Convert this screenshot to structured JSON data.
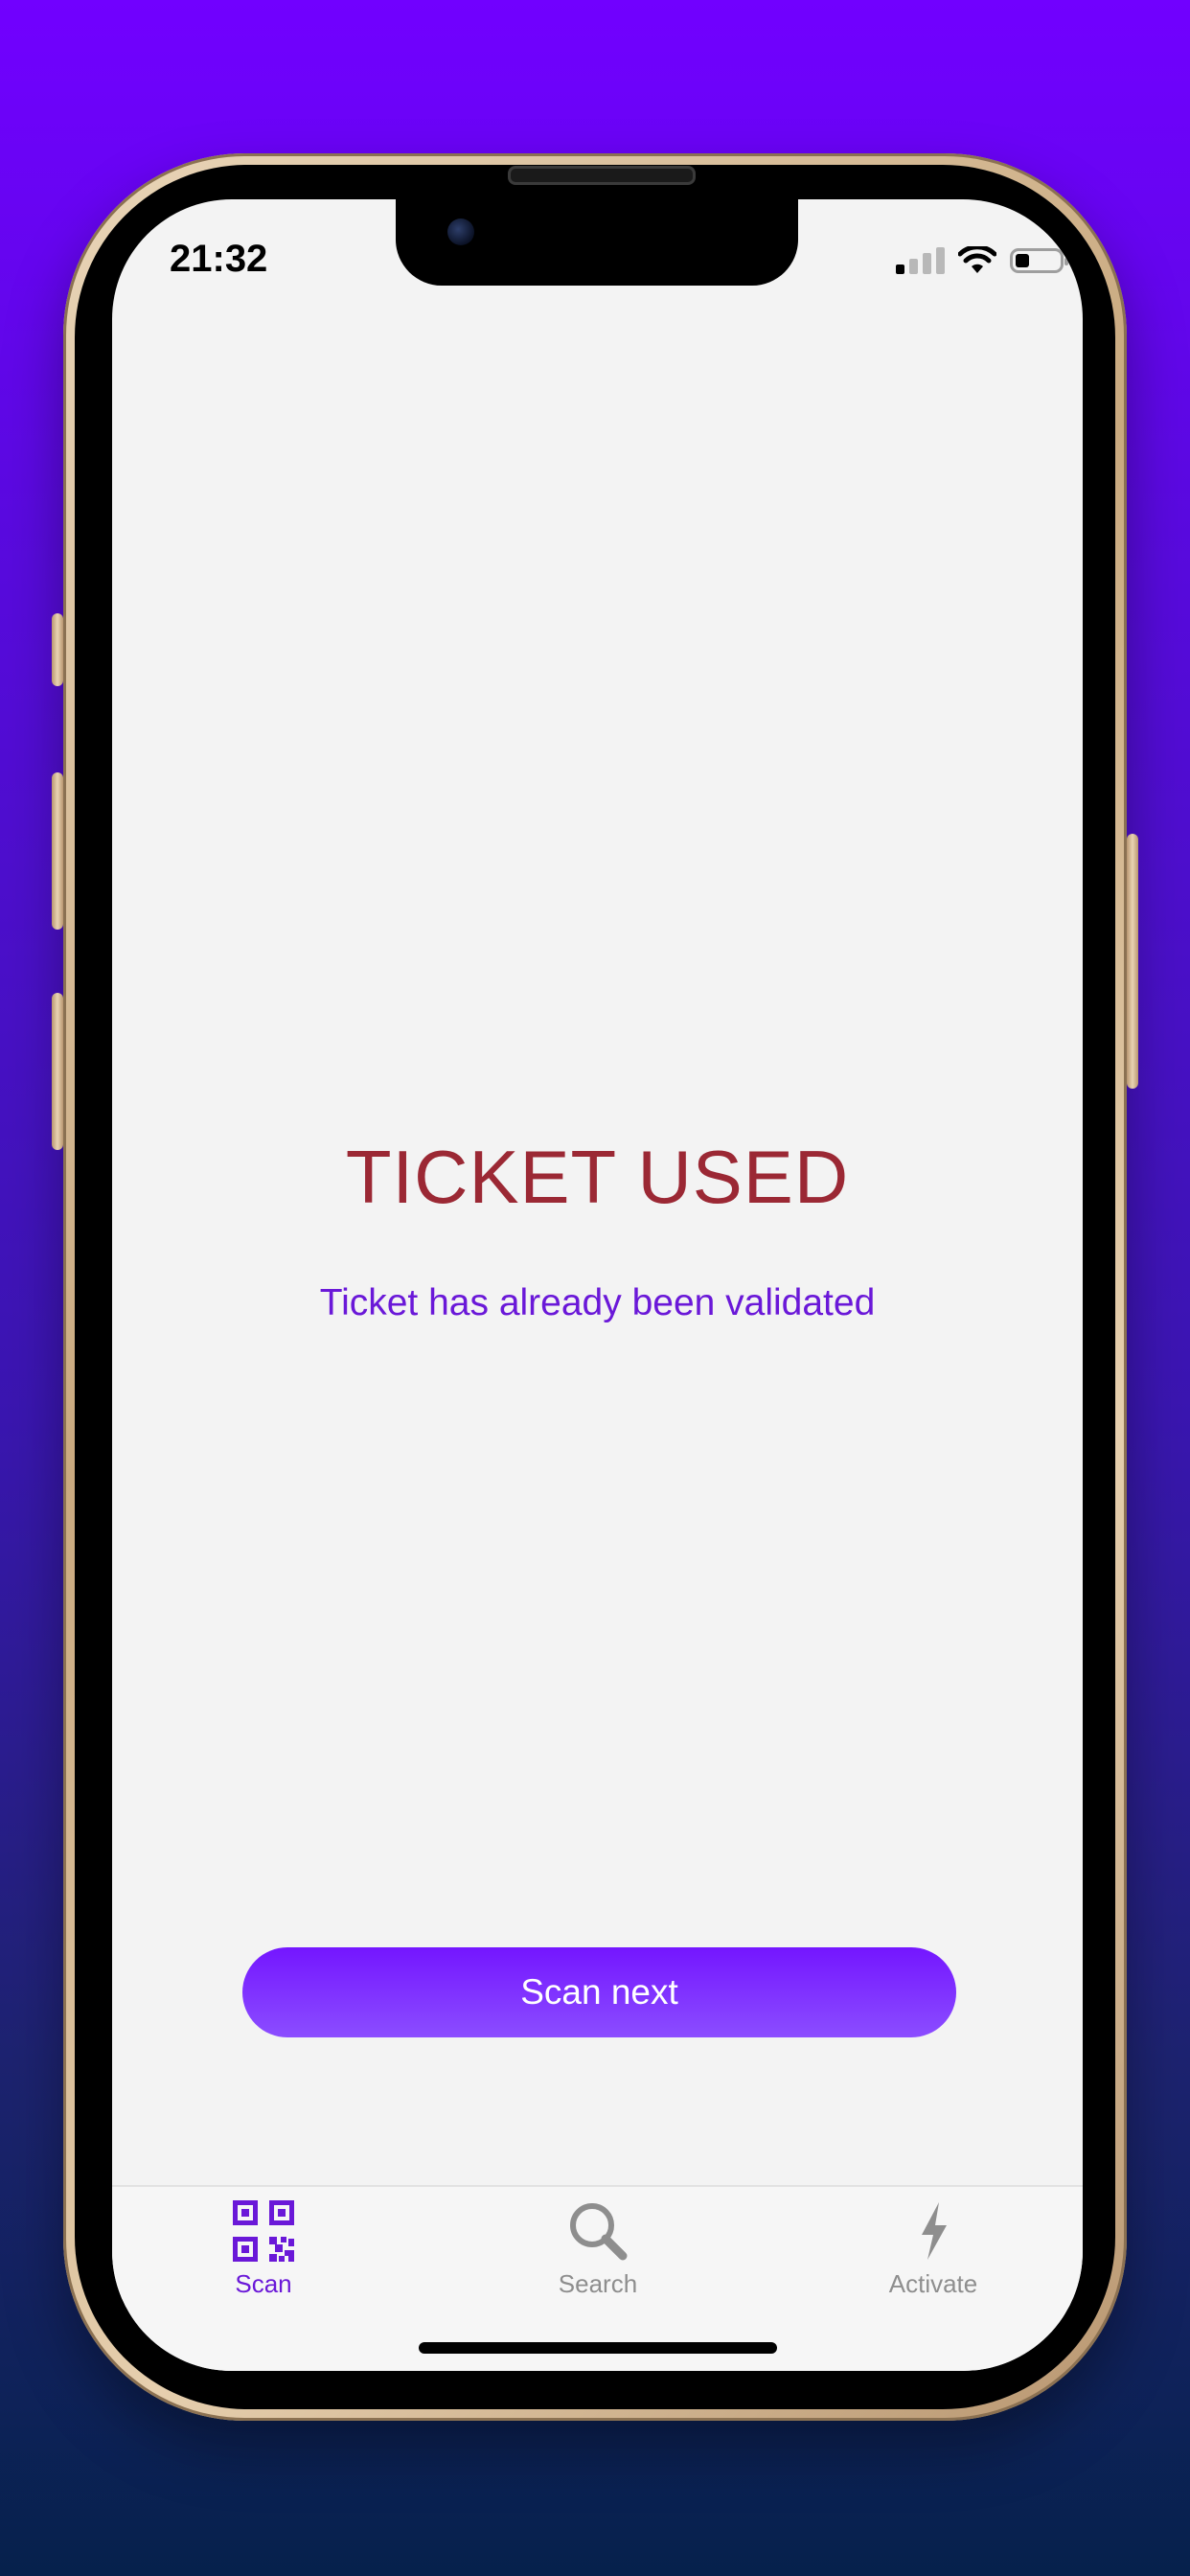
{
  "status_bar": {
    "time": "21:32"
  },
  "result": {
    "title": "TICKET USED",
    "message": "Ticket has already been validated"
  },
  "actions": {
    "scan_next_label": "Scan next"
  },
  "tabs": [
    {
      "label": "Scan",
      "icon": "qr-code-icon",
      "active": true
    },
    {
      "label": "Search",
      "icon": "magnifier-icon",
      "active": false
    },
    {
      "label": "Activate",
      "icon": "lightning-icon",
      "active": false
    }
  ],
  "colors": {
    "accent": "#6a18d8",
    "error": "#9b2834",
    "button": "#7416ff",
    "inactive": "#8e8e8e"
  }
}
